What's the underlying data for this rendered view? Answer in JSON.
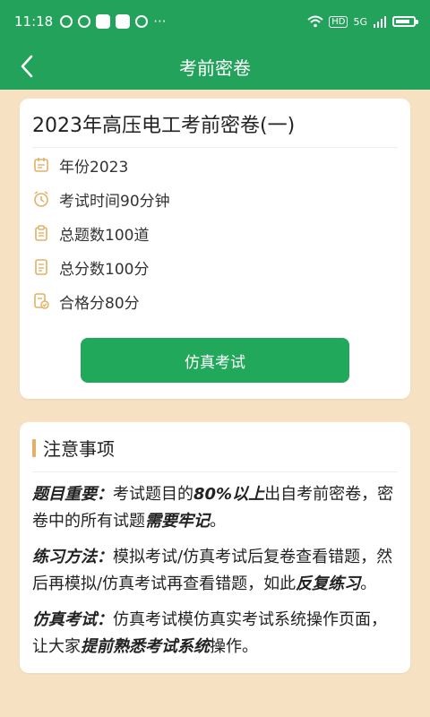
{
  "status": {
    "time": "11:18",
    "more": "···",
    "hd": "HD",
    "net": "5G",
    "battery_level": 0.85
  },
  "topbar": {
    "title": "考前密卷"
  },
  "exam": {
    "title": "2023年高压电工考前密卷(一)",
    "rows": [
      {
        "text": "年份2023"
      },
      {
        "text": "考试时间90分钟"
      },
      {
        "text": "总题数100道"
      },
      {
        "text": "总分数100分"
      },
      {
        "text": "合格分80分"
      }
    ],
    "button": "仿真考试"
  },
  "notes": {
    "title": "注意事项",
    "p1": {
      "label": "题目重要：",
      "t1": "考试题目的",
      "e1": "80%以上",
      "t2": "出自考前密卷，密卷中的所有试题",
      "e2": "需要牢记",
      "t3": "。"
    },
    "p2": {
      "label": "练习方法：",
      "t1": "模拟考试/仿真考试后复卷查看错题，然后再模拟/仿真考试再查看错题，如此",
      "e1": "反复练习",
      "t2": "。"
    },
    "p3": {
      "label": "仿真考试：",
      "t1": "仿真考试模仿真实考试系统操作页面，让大家",
      "e1": "提前熟悉考试系统",
      "t2": "操作。"
    }
  },
  "colors": {
    "green": "#22a25a",
    "background": "#f6e2c2",
    "accent": "#e3b066"
  }
}
